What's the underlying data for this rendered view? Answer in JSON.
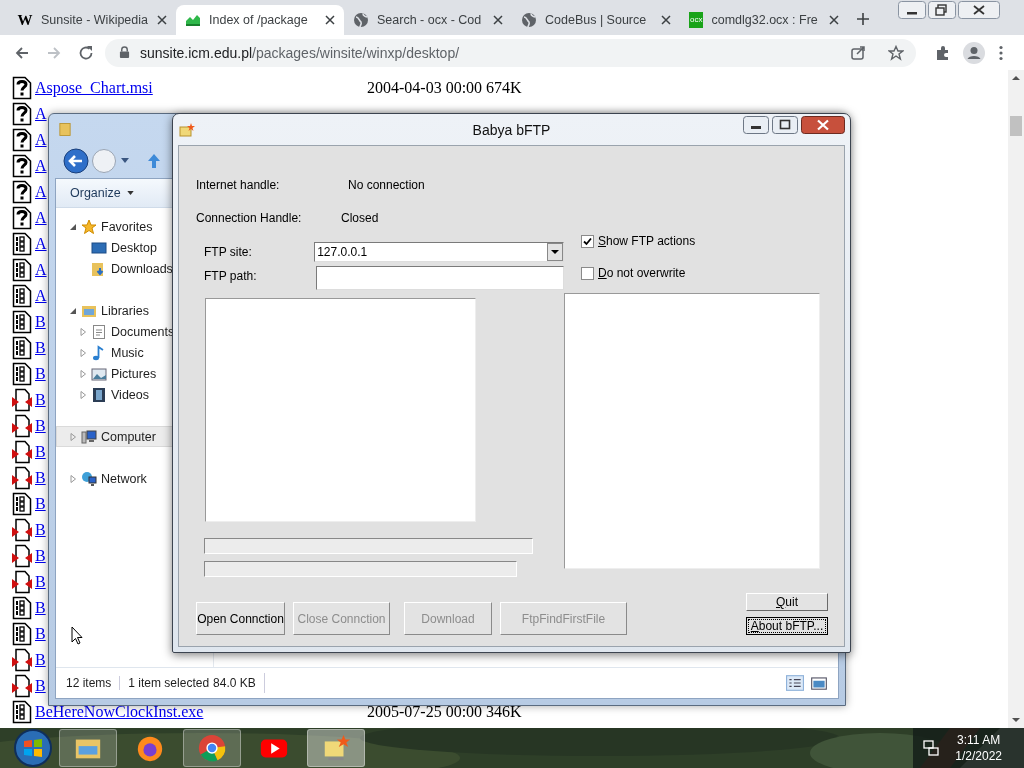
{
  "browser": {
    "tabs": [
      {
        "title": "Sunsite - Wikipedia",
        "kind": "letter",
        "icon_text": "W",
        "selected": false
      },
      {
        "title": "Index of /package",
        "kind": "logo",
        "selected": true
      },
      {
        "title": "Search - ocx - Cod",
        "kind": "globe",
        "selected": false
      },
      {
        "title": "CodeBus | Source",
        "kind": "globe",
        "selected": false
      },
      {
        "title": "comdlg32.ocx : Fre",
        "kind": "badge",
        "icon_text": "ocx",
        "selected": false
      }
    ],
    "address": {
      "host": "sunsite.icm.edu.pl",
      "path": "/packages/winsite/winxp/desktop/"
    }
  },
  "listing": [
    {
      "kind": "unknown",
      "name": "Aspose_Chart.msi",
      "modified": "2004-04-03 00:00",
      "size": "674K"
    },
    {
      "kind": "unknown",
      "name": "A"
    },
    {
      "kind": "unknown",
      "name": "A"
    },
    {
      "kind": "unknown",
      "name": "A"
    },
    {
      "kind": "unknown",
      "name": "A"
    },
    {
      "kind": "unknown",
      "name": "A"
    },
    {
      "kind": "binary",
      "name": "A"
    },
    {
      "kind": "binary",
      "name": "A"
    },
    {
      "kind": "binary",
      "name": "A"
    },
    {
      "kind": "binary",
      "name": "B"
    },
    {
      "kind": "binary",
      "name": "B"
    },
    {
      "kind": "binary",
      "name": "B"
    },
    {
      "kind": "installer",
      "name": "B"
    },
    {
      "kind": "installer",
      "name": "B"
    },
    {
      "kind": "installer",
      "name": "B"
    },
    {
      "kind": "installer",
      "name": "B"
    },
    {
      "kind": "binary",
      "name": "B"
    },
    {
      "kind": "installer",
      "name": "B"
    },
    {
      "kind": "installer",
      "name": "B"
    },
    {
      "kind": "installer",
      "name": "B"
    },
    {
      "kind": "binary",
      "name": "B"
    },
    {
      "kind": "binary",
      "name": "B"
    },
    {
      "kind": "installer",
      "name": "B"
    },
    {
      "kind": "installer",
      "name": "B"
    },
    {
      "kind": "binary",
      "name": "BeHereNowClockInst.exe",
      "modified": "2005-07-25 00:00",
      "size": "346K"
    }
  ],
  "explorer": {
    "toolbar": [
      {
        "label": "Organize",
        "dropdown": true
      }
    ],
    "nav": [
      {
        "label": "Favorites",
        "kind": "star",
        "expanded": true,
        "selected": false,
        "children": [
          {
            "label": "Desktop",
            "kind": "desktop",
            "selected": false
          },
          {
            "label": "Downloads",
            "kind": "downloads",
            "selected": false
          }
        ]
      },
      {
        "label": "Libraries",
        "kind": "library",
        "expanded": true,
        "selected": false,
        "children": [
          {
            "label": "Documents",
            "kind": "document",
            "expanded": false,
            "selected": false
          },
          {
            "label": "Music",
            "kind": "music",
            "expanded": false,
            "selected": false
          },
          {
            "label": "Pictures",
            "kind": "pictures",
            "expanded": false,
            "selected": false
          },
          {
            "label": "Videos",
            "kind": "video",
            "expanded": false,
            "selected": false
          }
        ]
      },
      {
        "label": "Computer",
        "kind": "computer",
        "expanded": false,
        "selected": true
      },
      {
        "label": "Network",
        "kind": "network",
        "expanded": false,
        "selected": false
      }
    ],
    "status": [
      "12 items",
      "1 item selected",
      "84.0 KB"
    ]
  },
  "ftp": {
    "title": "Babya bFTP",
    "info": [
      {
        "label": "Internet handle:",
        "value": "No connection"
      },
      {
        "label": "Connection Handle:",
        "value": "Closed"
      }
    ],
    "site": {
      "label": "FTP site:",
      "value": "127.0.0.1"
    },
    "path": {
      "label": "FTP path:"
    },
    "options": [
      {
        "label": "Show FTP actions",
        "checked": true
      },
      {
        "label": "Do not overwrite",
        "checked": false
      }
    ],
    "actions": [
      {
        "label": "Open Connction",
        "disabled": false
      },
      {
        "label": "Close Connction",
        "disabled": true
      },
      {
        "label": "Download",
        "disabled": true
      },
      {
        "label": "FtpFindFirstFile",
        "disabled": true
      }
    ],
    "side_buttons": [
      {
        "label": "Quit",
        "focused": false
      },
      {
        "label": "About bFTP...",
        "focused": true
      }
    ]
  },
  "taskbar": {
    "apps": [
      {
        "kind": "folder",
        "running": true,
        "selected": false
      },
      {
        "kind": "fox",
        "running": false,
        "selected": false
      },
      {
        "kind": "pinwheel",
        "running": true,
        "selected": false
      },
      {
        "kind": "play",
        "running": false,
        "selected": false
      },
      {
        "kind": "ftp",
        "running": true,
        "selected": true
      }
    ],
    "time": "3:11 AM",
    "date": "1/2/2022"
  }
}
